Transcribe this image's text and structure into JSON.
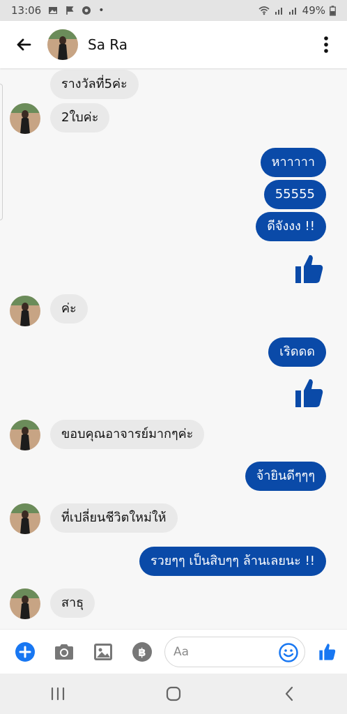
{
  "status_bar": {
    "time": "13:06",
    "battery": "49%"
  },
  "header": {
    "contact_name": "Sa Ra"
  },
  "messages": [
    {
      "dir": "in",
      "text": "รางวัลที่5ค่ะ"
    },
    {
      "dir": "in",
      "text": "2ใบค่ะ"
    },
    {
      "dir": "out",
      "text": "หาาาาา"
    },
    {
      "dir": "out",
      "text": "55555"
    },
    {
      "dir": "out",
      "text": "ดีจังงง !!"
    },
    {
      "dir": "out",
      "type": "like",
      "icon": "thumbs-up-icon"
    },
    {
      "dir": "in",
      "text": "ค่ะ"
    },
    {
      "dir": "out",
      "text": "เริดดด"
    },
    {
      "dir": "out",
      "type": "like",
      "icon": "thumbs-up-icon"
    },
    {
      "dir": "in",
      "text": "ขอบคุณอาจารย์มากๆค่ะ"
    },
    {
      "dir": "out",
      "text": "จ้ายินดีๆๆๆ"
    },
    {
      "dir": "in",
      "text": "ที่เปลี่ยนชีวิตใหม่ให้"
    },
    {
      "dir": "out",
      "text": "รวยๆๆ เป็นสิบๆๆ ล้านเลยนะ !!"
    },
    {
      "dir": "in",
      "text": "สาธุ"
    }
  ],
  "composer": {
    "placeholder": "Aa",
    "icons": [
      "plus-icon",
      "camera-icon",
      "image-icon",
      "baht-icon",
      "emoji-icon",
      "thumbs-up-icon"
    ]
  },
  "colors": {
    "accent": "#0a4aa8",
    "incoming_bubble": "#e9e9e9",
    "messenger_blue": "#1877f2"
  }
}
